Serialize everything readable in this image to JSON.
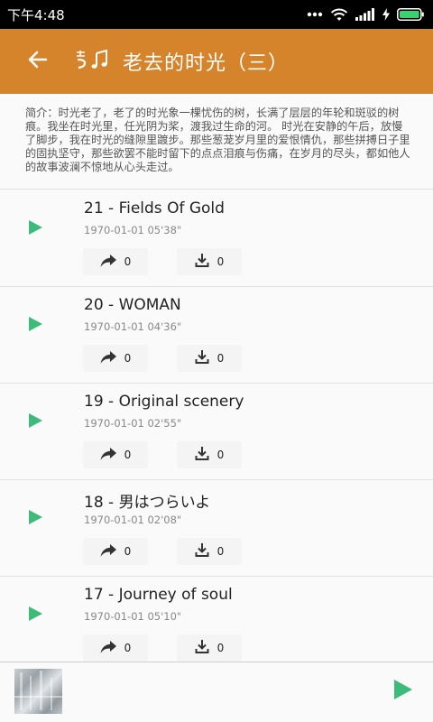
{
  "status_bar": {
    "time": "下午4:48"
  },
  "app_bar": {
    "title": "老去的时光（三）",
    "back_icon": "arrow-left-icon",
    "music_icon": "music-note-icon"
  },
  "intro": {
    "text": "简介：时光老了，老了的时光象一棵忧伤的树，长满了层层的年轮和斑驳的树痕。我坐在时光里，任光阴为桨，渡我过生命的河。 时光在安静的午后，放慢了脚步，我在时光的缝隙里踱步。那些葱茏岁月里的爱恨情仇，那些拼搏日子里的固执坚守，那些欲罢不能时留下的点点泪痕与伤痛，在岁月的尽头，都如他人的故事波澜不惊地从心头走过。"
  },
  "tracks": [
    {
      "title": "21 - Fields Of Gold",
      "date": "1970-01-01",
      "duration": "05'38\"",
      "meta": "1970-01-01  05'38\"",
      "shares": "0",
      "downloads": "0"
    },
    {
      "title": "20 - WOMAN",
      "date": "1970-01-01",
      "duration": "04'36\"",
      "meta": "1970-01-01  04'36\"",
      "shares": "0",
      "downloads": "0"
    },
    {
      "title": "19 -  Original scenery",
      "date": "1970-01-01",
      "duration": "02'55\"",
      "meta": "1970-01-01  02'55\"",
      "shares": "0",
      "downloads": "0"
    },
    {
      "title": "18 -  男はつらいよ",
      "date": "1970-01-01",
      "duration": "02'08\"",
      "meta": "1970-01-01  02'08\"",
      "shares": "0",
      "downloads": "0"
    },
    {
      "title": "17 - Journey of soul",
      "date": "1970-01-01",
      "duration": "05'10\"",
      "meta": "1970-01-01  05'10\"",
      "shares": "0",
      "downloads": "0"
    }
  ],
  "colors": {
    "app_bar": "#d6842b",
    "play_green": "#3dbb7a",
    "background": "#fafafa"
  },
  "icons": {
    "play": "play-icon",
    "share": "share-icon",
    "download": "download-icon"
  }
}
